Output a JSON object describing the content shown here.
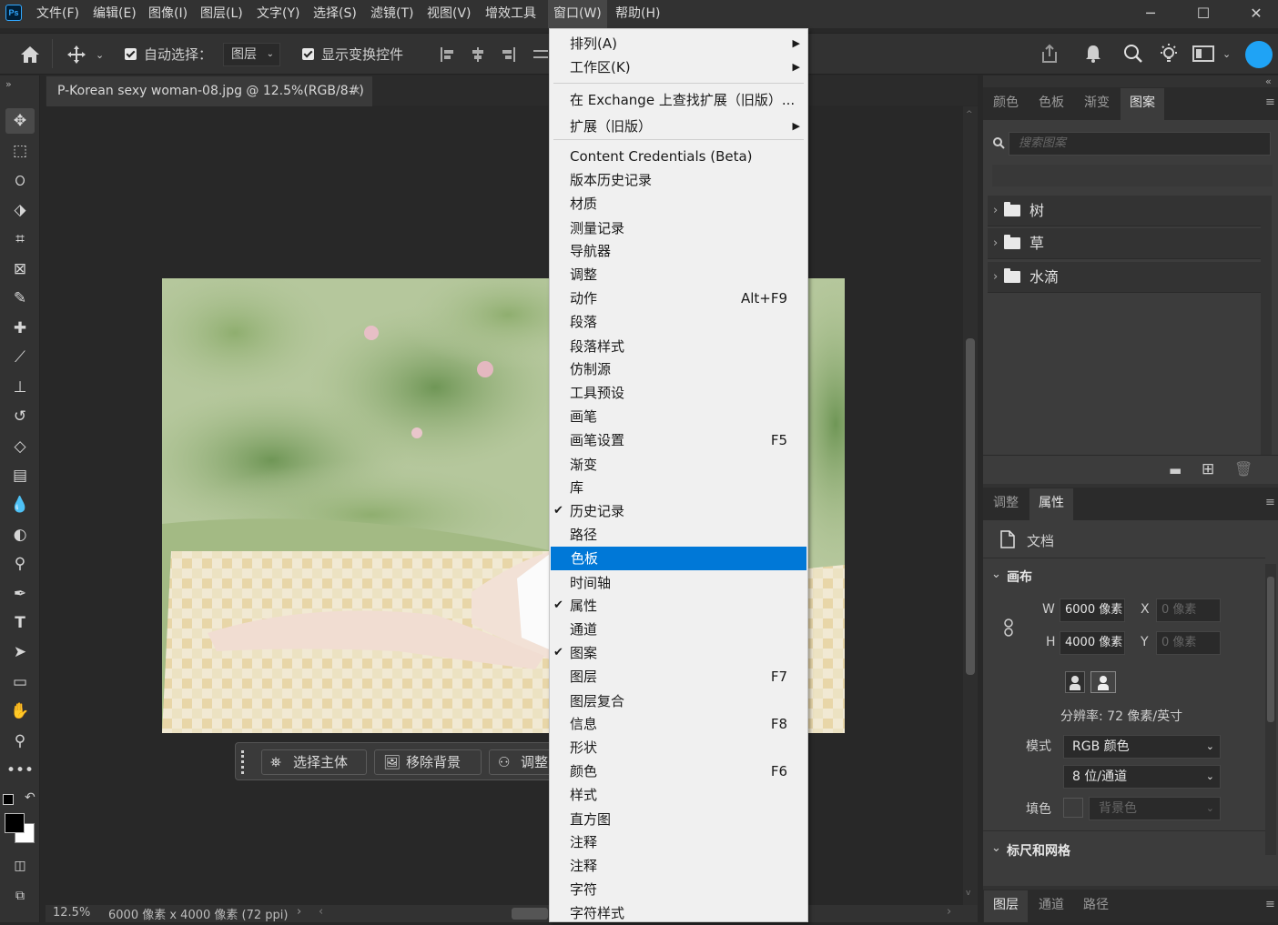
{
  "app": {
    "logo": "Ps"
  },
  "menubar": {
    "items": [
      "文件(F)",
      "编辑(E)",
      "图像(I)",
      "图层(L)",
      "文字(Y)",
      "选择(S)",
      "滤镜(T)",
      "视图(V)",
      "增效工具",
      "窗口(W)",
      "帮助(H)"
    ],
    "window_controls": {
      "minimize": "─",
      "maximize": "☐",
      "close": "✕"
    }
  },
  "options": {
    "auto_select_label": "自动选择：",
    "auto_select_target": "图层",
    "show_transform_label": "显示变换控件"
  },
  "tools": [
    "move-tool",
    "marquee-tool",
    "lasso-tool",
    "object-select-tool",
    "crop-tool",
    "frame-tool",
    "eyedropper-tool",
    "healing-brush-tool",
    "brush-tool",
    "clone-stamp-tool",
    "history-brush-tool",
    "eraser-tool",
    "gradient-tool",
    "blur-tool",
    "dodge-tool",
    "pen-tool",
    "type-tool",
    "path-select-tool",
    "rectangle-tool",
    "hand-tool",
    "zoom-tool",
    "more-tools"
  ],
  "document": {
    "tab_title": "P-Korean sexy woman-08.jpg @ 12.5%(RGB/8#)",
    "close": "×"
  },
  "status": {
    "zoom": "12.5%",
    "info": "6000 像素 x 4000 像素 (72 ppi)"
  },
  "context_bar": {
    "select_subject": "选择主体",
    "remove_bg": "移除背景",
    "adjust": "调整"
  },
  "window_menu": {
    "items": [
      {
        "label": "排列(A)",
        "submenu": true
      },
      {
        "label": "工作区(K)",
        "submenu": true
      },
      {
        "sep": true
      },
      {
        "label": "在 Exchange 上查找扩展（旧版）..."
      },
      {
        "label": "扩展（旧版）",
        "submenu": true
      },
      {
        "sep": true
      },
      {
        "label": "Content Credentials (Beta)"
      },
      {
        "label": "版本历史记录"
      },
      {
        "label": "材质"
      },
      {
        "label": "测量记录"
      },
      {
        "label": "导航器"
      },
      {
        "label": "调整"
      },
      {
        "label": "动作",
        "shortcut": "Alt+F9"
      },
      {
        "label": "段落"
      },
      {
        "label": "段落样式"
      },
      {
        "label": "仿制源"
      },
      {
        "label": "工具预设"
      },
      {
        "label": "画笔"
      },
      {
        "label": "画笔设置",
        "shortcut": "F5"
      },
      {
        "label": "渐变"
      },
      {
        "label": "库"
      },
      {
        "label": "历史记录",
        "checked": true
      },
      {
        "label": "路径"
      },
      {
        "label": "色板",
        "highlighted": true
      },
      {
        "label": "时间轴"
      },
      {
        "label": "属性",
        "checked": true
      },
      {
        "label": "通道"
      },
      {
        "label": "图案",
        "checked": true
      },
      {
        "label": "图层",
        "shortcut": "F7"
      },
      {
        "label": "图层复合"
      },
      {
        "label": "信息",
        "shortcut": "F8"
      },
      {
        "label": "形状"
      },
      {
        "label": "颜色",
        "shortcut": "F6"
      },
      {
        "label": "样式"
      },
      {
        "label": "直方图"
      },
      {
        "label": "注释"
      },
      {
        "label": "注释"
      },
      {
        "label": "字符"
      },
      {
        "label": "字符样式"
      }
    ],
    "checkmark": "✔",
    "arrow": "▶"
  },
  "panels": {
    "top_tabs": [
      "颜色",
      "色板",
      "渐变",
      "图案"
    ],
    "search_placeholder": "搜索图案",
    "pattern_groups": [
      "树",
      "草",
      "水滴"
    ],
    "mid_tabs": [
      "调整",
      "属性"
    ],
    "props": {
      "doc_label": "文档",
      "canvas_section": "画布",
      "w_label": "W",
      "w_value": "6000 像素",
      "h_label": "H",
      "h_value": "4000 像素",
      "x_label": "X",
      "x_value": "0 像素",
      "y_label": "Y",
      "y_value": "0 像素",
      "resolution": "分辨率: 72 像素/英寸",
      "mode_label": "模式",
      "mode_value": "RGB 颜色",
      "depth_value": "8 位/通道",
      "fill_label": "填色",
      "fill_value": "背景色",
      "rulers_section": "标尺和网格"
    },
    "bottom_tabs": [
      "图层",
      "通道",
      "路径"
    ]
  },
  "colors": {
    "accent": "#0078d7",
    "brand_blue": "#31a8ff"
  }
}
